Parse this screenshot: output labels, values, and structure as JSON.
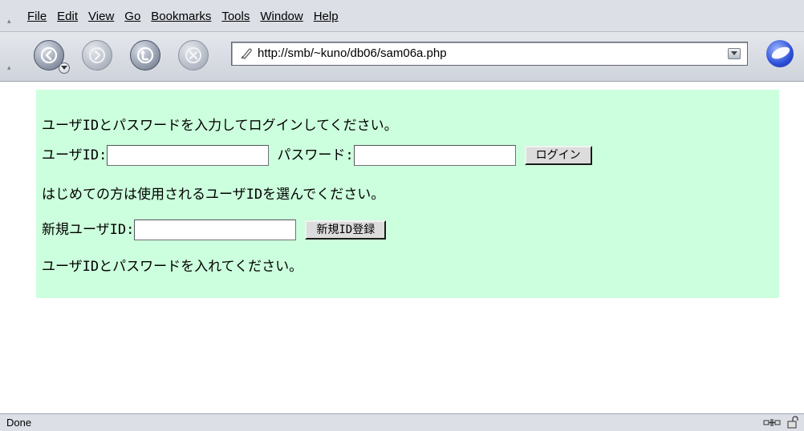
{
  "menu": {
    "items": [
      {
        "label": "File"
      },
      {
        "label": "Edit"
      },
      {
        "label": "View"
      },
      {
        "label": "Go"
      },
      {
        "label": "Bookmarks"
      },
      {
        "label": "Tools"
      },
      {
        "label": "Window"
      },
      {
        "label": "Help"
      }
    ]
  },
  "toolbar": {
    "icons": [
      "back-icon",
      "forward-icon",
      "reload-icon",
      "stop-icon"
    ],
    "url": "http://smb/~kuno/db06/sam06a.php"
  },
  "content": {
    "background": "#ccffdd",
    "intro": "ユーザIDとパスワードを入力してログインしてください。",
    "userid_label": "ユーザID:",
    "password_label": "パスワード:",
    "login_button": "ログイン",
    "new_user_intro": "はじめての方は使用されるユーザIDを選んでください。",
    "new_userid_label": "新規ユーザID:",
    "register_button": "新規ID登録",
    "message": "ユーザIDとパスワードを入れてください。"
  },
  "status": {
    "text": "Done"
  }
}
